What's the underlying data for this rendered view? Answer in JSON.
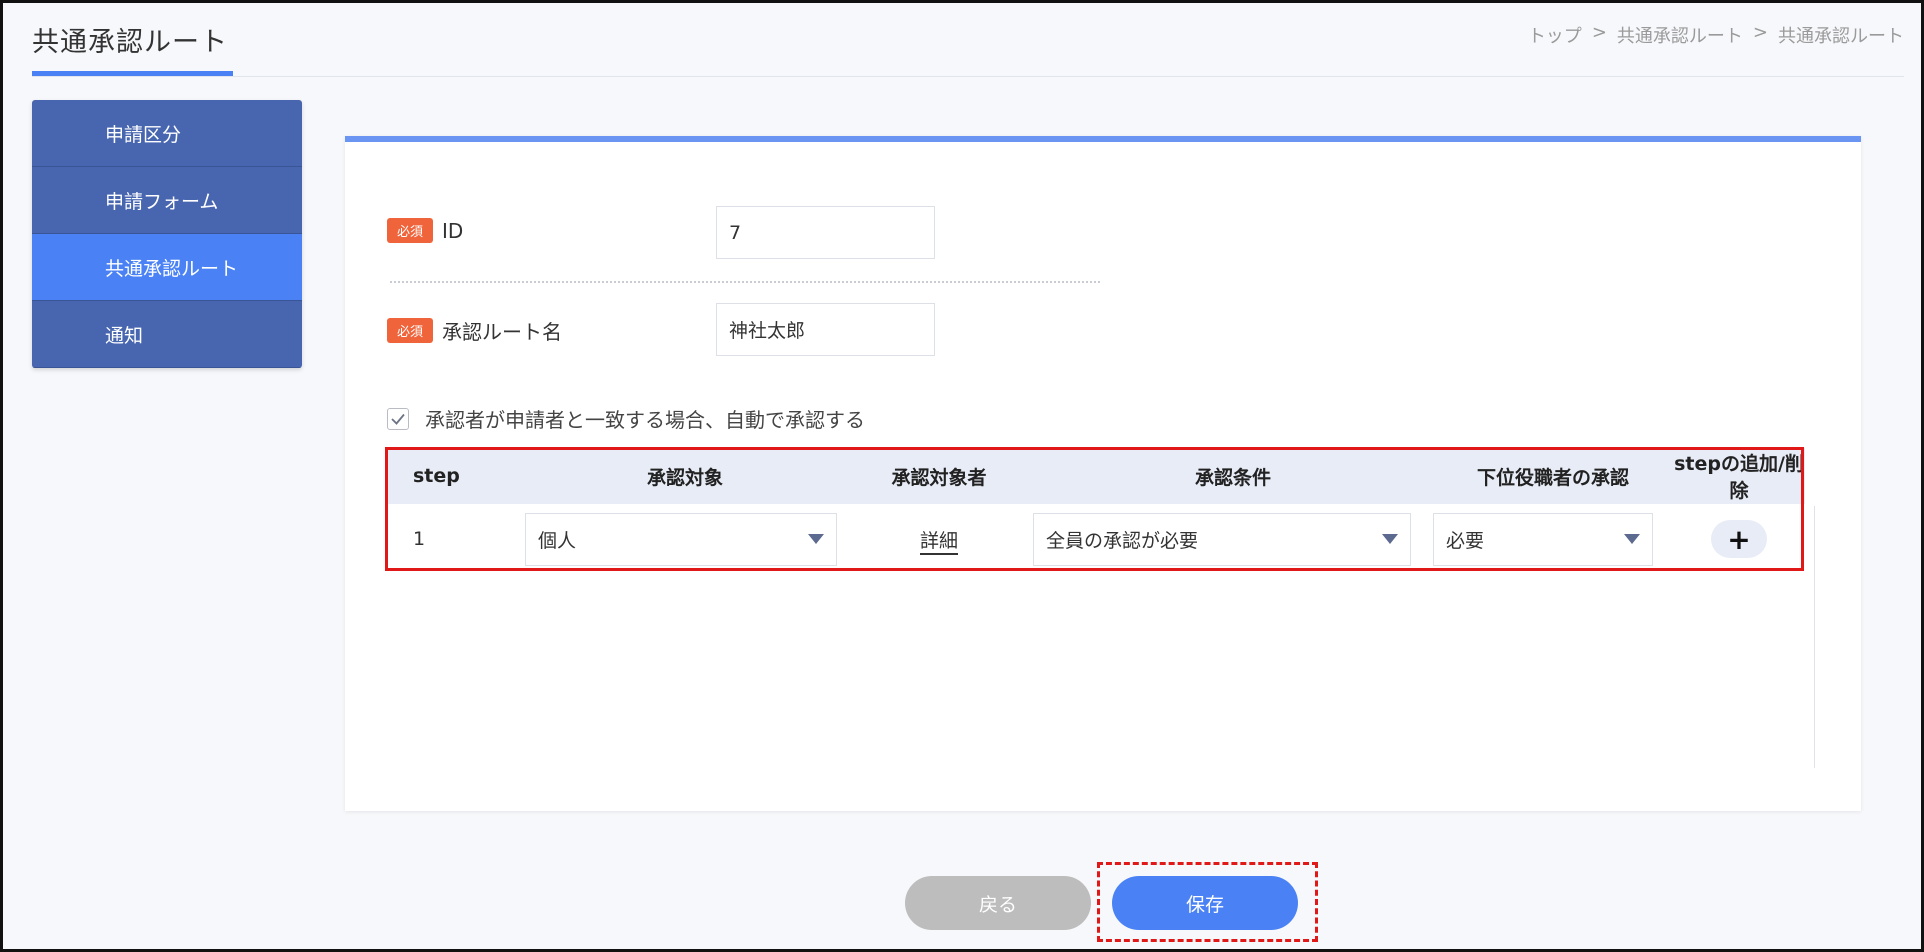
{
  "header": {
    "title": "共通承認ルート",
    "breadcrumb": [
      "トップ",
      "共通承認ルート",
      "共通承認ルート"
    ],
    "breadcrumb_sep": ">"
  },
  "sidebar": {
    "items": [
      {
        "label": "申請区分"
      },
      {
        "label": "申請フォーム"
      },
      {
        "label": "共通承認ルート",
        "active": true
      },
      {
        "label": "通知"
      }
    ]
  },
  "form": {
    "required_badge": "必須",
    "id_label": "ID",
    "id_value": "7",
    "route_name_label": "承認ルート名",
    "route_name_value": "神社太郎",
    "auto_approve_label": "承認者が申請者と一致する場合、自動で承認する",
    "auto_approve_checked": true
  },
  "table": {
    "headers": {
      "step": "step",
      "target": "承認対象",
      "person": "承認対象者",
      "condition": "承認条件",
      "lower": "下位役職者の承認",
      "add": "stepの追加/削除"
    },
    "rows": [
      {
        "step": "1",
        "target": "個人",
        "person_link": "詳細",
        "condition": "全員の承認が必要",
        "lower": "必要",
        "add_symbol": "+"
      }
    ]
  },
  "buttons": {
    "back": "戻る",
    "save": "保存"
  },
  "colors": {
    "accent": "#4a82f5",
    "sidebar": "#4866b0",
    "required": "#f0643c",
    "highlight": "#e01818"
  }
}
